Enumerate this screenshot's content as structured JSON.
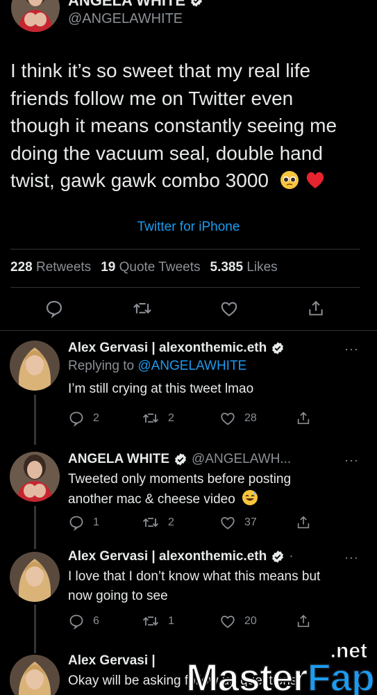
{
  "main_tweet": {
    "author_name": "ANGELA WHITE",
    "handle": "@ANGELAWHITE",
    "text_lines": [
      "I think it’s so sweet that my real life",
      "friends follow me on Twitter even",
      "though it means constantly seeing me",
      "doing the vacuum seal, double hand",
      "twist, gawk gawk combo 3000"
    ],
    "source": "Twitter for iPhone",
    "stats": {
      "retweets_count": "228",
      "retweets_label": "Retweets",
      "quotes_count": "19",
      "quotes_label": "Quote Tweets",
      "likes_count": "5.385",
      "likes_label": "Likes"
    }
  },
  "replies": [
    {
      "name": "Alex Gervasi | alexonthemic.eth",
      "handle": "",
      "replying_prefix": "Replying to",
      "replying_to": "@ANGELAWHITE",
      "lines": [
        "I’m still crying at this tweet lmao"
      ],
      "reply_count": "2",
      "retweet_count": "2",
      "like_count": "28"
    },
    {
      "name": "ANGELA WHITE",
      "handle": "@ANGELAWH...",
      "lines": [
        "Tweeted only moments before posting",
        "another mac & cheese video"
      ],
      "reply_count": "1",
      "retweet_count": "2",
      "like_count": "37"
    },
    {
      "name": "Alex Gervasi | alexonthemic.eth",
      "handle": "·",
      "lines": [
        "I love that I don’t know what this means but",
        "now going to see"
      ],
      "reply_count": "6",
      "retweet_count": "1",
      "like_count": "20"
    },
    {
      "name": "Alex Gervasi |",
      "handle": "",
      "lines": [
        "Okay will be asking follow up questions"
      ]
    }
  ],
  "watermark": {
    "net": ".net",
    "part1": "Master",
    "part2": "Fap"
  },
  "colors": {
    "background": "#000000",
    "accent": "#1d9bf0",
    "muted": "#8b9096",
    "text": "#e7e9ea",
    "divider": "#2f3336"
  },
  "icons": [
    "reply-icon",
    "retweet-icon",
    "like-icon",
    "share-icon",
    "verified-badge-icon",
    "more-dots-icon"
  ]
}
